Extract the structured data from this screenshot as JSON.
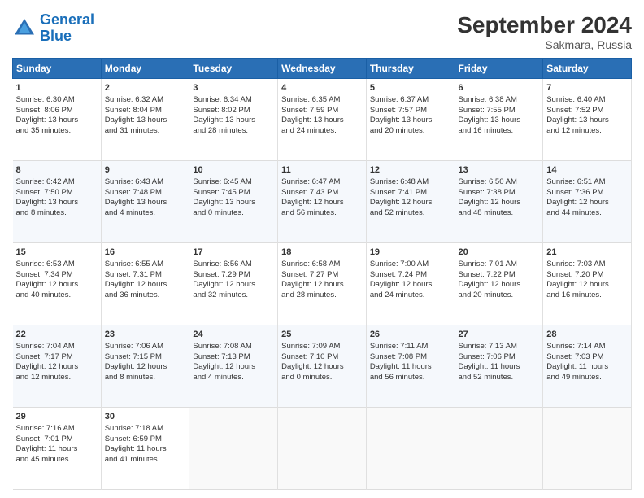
{
  "header": {
    "logo_line1": "General",
    "logo_line2": "Blue",
    "month": "September 2024",
    "location": "Sakmara, Russia"
  },
  "days_of_week": [
    "Sunday",
    "Monday",
    "Tuesday",
    "Wednesday",
    "Thursday",
    "Friday",
    "Saturday"
  ],
  "weeks": [
    [
      {
        "day": "1",
        "lines": [
          "Sunrise: 6:30 AM",
          "Sunset: 8:06 PM",
          "Daylight: 13 hours",
          "and 35 minutes."
        ]
      },
      {
        "day": "2",
        "lines": [
          "Sunrise: 6:32 AM",
          "Sunset: 8:04 PM",
          "Daylight: 13 hours",
          "and 31 minutes."
        ]
      },
      {
        "day": "3",
        "lines": [
          "Sunrise: 6:34 AM",
          "Sunset: 8:02 PM",
          "Daylight: 13 hours",
          "and 28 minutes."
        ]
      },
      {
        "day": "4",
        "lines": [
          "Sunrise: 6:35 AM",
          "Sunset: 7:59 PM",
          "Daylight: 13 hours",
          "and 24 minutes."
        ]
      },
      {
        "day": "5",
        "lines": [
          "Sunrise: 6:37 AM",
          "Sunset: 7:57 PM",
          "Daylight: 13 hours",
          "and 20 minutes."
        ]
      },
      {
        "day": "6",
        "lines": [
          "Sunrise: 6:38 AM",
          "Sunset: 7:55 PM",
          "Daylight: 13 hours",
          "and 16 minutes."
        ]
      },
      {
        "day": "7",
        "lines": [
          "Sunrise: 6:40 AM",
          "Sunset: 7:52 PM",
          "Daylight: 13 hours",
          "and 12 minutes."
        ]
      }
    ],
    [
      {
        "day": "8",
        "lines": [
          "Sunrise: 6:42 AM",
          "Sunset: 7:50 PM",
          "Daylight: 13 hours",
          "and 8 minutes."
        ]
      },
      {
        "day": "9",
        "lines": [
          "Sunrise: 6:43 AM",
          "Sunset: 7:48 PM",
          "Daylight: 13 hours",
          "and 4 minutes."
        ]
      },
      {
        "day": "10",
        "lines": [
          "Sunrise: 6:45 AM",
          "Sunset: 7:45 PM",
          "Daylight: 13 hours",
          "and 0 minutes."
        ]
      },
      {
        "day": "11",
        "lines": [
          "Sunrise: 6:47 AM",
          "Sunset: 7:43 PM",
          "Daylight: 12 hours",
          "and 56 minutes."
        ]
      },
      {
        "day": "12",
        "lines": [
          "Sunrise: 6:48 AM",
          "Sunset: 7:41 PM",
          "Daylight: 12 hours",
          "and 52 minutes."
        ]
      },
      {
        "day": "13",
        "lines": [
          "Sunrise: 6:50 AM",
          "Sunset: 7:38 PM",
          "Daylight: 12 hours",
          "and 48 minutes."
        ]
      },
      {
        "day": "14",
        "lines": [
          "Sunrise: 6:51 AM",
          "Sunset: 7:36 PM",
          "Daylight: 12 hours",
          "and 44 minutes."
        ]
      }
    ],
    [
      {
        "day": "15",
        "lines": [
          "Sunrise: 6:53 AM",
          "Sunset: 7:34 PM",
          "Daylight: 12 hours",
          "and 40 minutes."
        ]
      },
      {
        "day": "16",
        "lines": [
          "Sunrise: 6:55 AM",
          "Sunset: 7:31 PM",
          "Daylight: 12 hours",
          "and 36 minutes."
        ]
      },
      {
        "day": "17",
        "lines": [
          "Sunrise: 6:56 AM",
          "Sunset: 7:29 PM",
          "Daylight: 12 hours",
          "and 32 minutes."
        ]
      },
      {
        "day": "18",
        "lines": [
          "Sunrise: 6:58 AM",
          "Sunset: 7:27 PM",
          "Daylight: 12 hours",
          "and 28 minutes."
        ]
      },
      {
        "day": "19",
        "lines": [
          "Sunrise: 7:00 AM",
          "Sunset: 7:24 PM",
          "Daylight: 12 hours",
          "and 24 minutes."
        ]
      },
      {
        "day": "20",
        "lines": [
          "Sunrise: 7:01 AM",
          "Sunset: 7:22 PM",
          "Daylight: 12 hours",
          "and 20 minutes."
        ]
      },
      {
        "day": "21",
        "lines": [
          "Sunrise: 7:03 AM",
          "Sunset: 7:20 PM",
          "Daylight: 12 hours",
          "and 16 minutes."
        ]
      }
    ],
    [
      {
        "day": "22",
        "lines": [
          "Sunrise: 7:04 AM",
          "Sunset: 7:17 PM",
          "Daylight: 12 hours",
          "and 12 minutes."
        ]
      },
      {
        "day": "23",
        "lines": [
          "Sunrise: 7:06 AM",
          "Sunset: 7:15 PM",
          "Daylight: 12 hours",
          "and 8 minutes."
        ]
      },
      {
        "day": "24",
        "lines": [
          "Sunrise: 7:08 AM",
          "Sunset: 7:13 PM",
          "Daylight: 12 hours",
          "and 4 minutes."
        ]
      },
      {
        "day": "25",
        "lines": [
          "Sunrise: 7:09 AM",
          "Sunset: 7:10 PM",
          "Daylight: 12 hours",
          "and 0 minutes."
        ]
      },
      {
        "day": "26",
        "lines": [
          "Sunrise: 7:11 AM",
          "Sunset: 7:08 PM",
          "Daylight: 11 hours",
          "and 56 minutes."
        ]
      },
      {
        "day": "27",
        "lines": [
          "Sunrise: 7:13 AM",
          "Sunset: 7:06 PM",
          "Daylight: 11 hours",
          "and 52 minutes."
        ]
      },
      {
        "day": "28",
        "lines": [
          "Sunrise: 7:14 AM",
          "Sunset: 7:03 PM",
          "Daylight: 11 hours",
          "and 49 minutes."
        ]
      }
    ],
    [
      {
        "day": "29",
        "lines": [
          "Sunrise: 7:16 AM",
          "Sunset: 7:01 PM",
          "Daylight: 11 hours",
          "and 45 minutes."
        ]
      },
      {
        "day": "30",
        "lines": [
          "Sunrise: 7:18 AM",
          "Sunset: 6:59 PM",
          "Daylight: 11 hours",
          "and 41 minutes."
        ]
      },
      null,
      null,
      null,
      null,
      null
    ]
  ]
}
